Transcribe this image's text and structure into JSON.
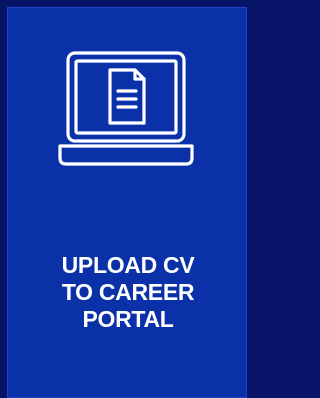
{
  "card": {
    "icon": "laptop-document-icon",
    "lines": [
      "UPLOAD CV",
      "TO CAREER",
      "PORTAL"
    ]
  },
  "colors": {
    "page_background": "#071468",
    "card_background": "#0a31a8",
    "foreground": "#ffffff"
  }
}
